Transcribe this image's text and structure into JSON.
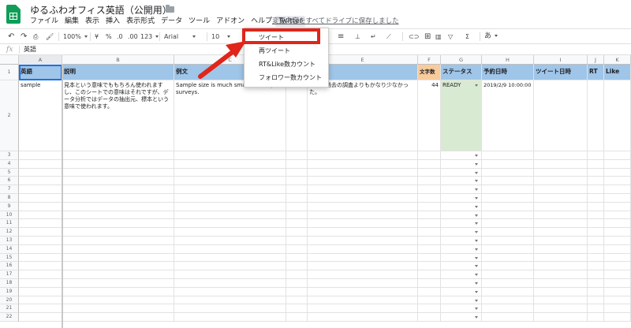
{
  "doc": {
    "title": "ゆるふわオフィス英語（公開用）",
    "save_status": "変更内容をすべてドライブに保存しました"
  },
  "menu": [
    "ファイル",
    "編集",
    "表示",
    "挿入",
    "表示形式",
    "データ",
    "ツール",
    "アドオン",
    "ヘルプ",
    "Twitter"
  ],
  "toolbar": {
    "zoom": "100%",
    "currency": "¥",
    "percent": "%",
    "dec_less": ".0",
    "dec_more": ".00",
    "format": "123",
    "font": "Arial",
    "size": "10",
    "text_a": "あ"
  },
  "formula": {
    "fx": "fx",
    "value": "英語"
  },
  "twitter_menu": [
    "ツイート",
    "再ツイート",
    "RT&Like数カウント",
    "フォロワー数カウント"
  ],
  "columns": [
    "A",
    "B",
    "C",
    "D",
    "E",
    "F",
    "G",
    "H",
    "I",
    "J",
    "K"
  ],
  "header_row": [
    "英語",
    "説明",
    "例文",
    "",
    "",
    "文字数2",
    "ステータス",
    "予約日時",
    "ツイート日時",
    "RT",
    "Like"
  ],
  "data_row": {
    "a": "sample",
    "b": "見本という意味でももちろん使われますし、このシートでの意味はそれですが、データ分析ではデータの抽出元、標本という意味で使われます。",
    "c": "Sample size is much smaller than past surveys.",
    "d": "279",
    "e": "標本が過去の調査よりもかなり少なかった。",
    "f": "44",
    "g": "READY",
    "h": "2019/2/9 10:00:00"
  },
  "row_numbers": [
    "1",
    "2",
    "3",
    "4",
    "5",
    "6",
    "7",
    "8",
    "9",
    "10",
    "11",
    "12",
    "13",
    "14",
    "15",
    "16",
    "17",
    "18",
    "19",
    "20",
    "21",
    "22"
  ],
  "colors": {
    "header_blue": "#9fc5e8",
    "header_peach": "#f9cb9c",
    "ready_green": "#d9ead3",
    "annotation_red": "#e0251b",
    "sheets_green": "#0f9d58"
  }
}
